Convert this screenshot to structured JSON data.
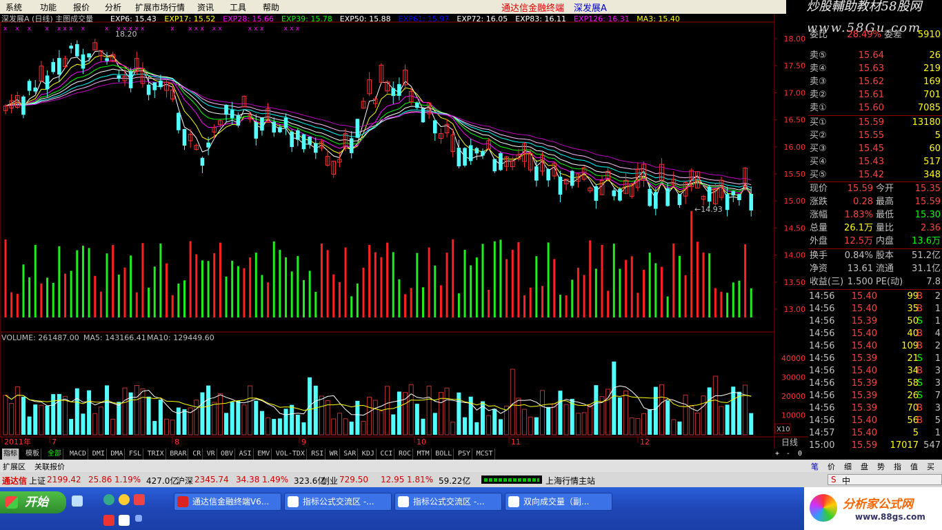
{
  "menu": {
    "items": [
      "系统",
      "功能",
      "报价",
      "分析",
      "扩展市场行情",
      "资讯",
      "工具",
      "帮助"
    ],
    "app_title": "通达信金融终端",
    "stock": "深发展A",
    "watermark1": "炒股輔助教材58股网",
    "watermark2": "www.58Gu.com"
  },
  "indicator_line": {
    "title": "深发展A (日线) 主图成交量",
    "items": [
      {
        "label": "EXP6: 15.43",
        "color": "#ffffff"
      },
      {
        "label": "EXP17: 15.52",
        "color": "#ffff00"
      },
      {
        "label": "EXP28: 15.66",
        "color": "#ff00ff"
      },
      {
        "label": "EXP39: 15.78",
        "color": "#00ff00"
      },
      {
        "label": "EXP50: 15.88",
        "color": "#ffffff"
      },
      {
        "label": "EXP61: 15.97",
        "color": "#0000ff"
      },
      {
        "label": "EXP72: 16.05",
        "color": "#ffffff"
      },
      {
        "label": "EXP83: 16.11",
        "color": "#ffffff"
      },
      {
        "label": "EXP126: 16.31",
        "color": "#ff00ff"
      },
      {
        "label": "MA3: 15.40",
        "color": "#ffff00"
      }
    ]
  },
  "price_axis": [
    "18.00",
    "17.50",
    "17.00",
    "16.50",
    "16.00",
    "15.50",
    "15.00",
    "14.50",
    "14.00",
    "13.50",
    "13.00"
  ],
  "high_label": "18.20",
  "low_label": "←14.93",
  "vol_title": {
    "label": "VOLUME: 261487.00",
    "ma5": "MA5: 143166.41",
    "ma10": "MA10: 129449.60"
  },
  "vol_axis": [
    "40000",
    "30000",
    "20000",
    "10000"
  ],
  "vol_unit": "X10",
  "date_axis": [
    "2011年",
    "7",
    "8",
    "9",
    "10",
    "11",
    "12"
  ],
  "period": "日线",
  "quote": {
    "partial": {
      "left": "委比",
      "v1": "28.49%",
      "mid": "委差",
      "v2": "5910"
    },
    "asks": [
      {
        "label": "卖⑤",
        "price": "15.64",
        "vol": "26"
      },
      {
        "label": "卖④",
        "price": "15.63",
        "vol": "219"
      },
      {
        "label": "卖③",
        "price": "15.62",
        "vol": "169"
      },
      {
        "label": "卖②",
        "price": "15.61",
        "vol": "701"
      },
      {
        "label": "卖①",
        "price": "15.60",
        "vol": "7085"
      }
    ],
    "bids": [
      {
        "label": "买①",
        "price": "15.59",
        "vol": "13180"
      },
      {
        "label": "买②",
        "price": "15.55",
        "vol": "5"
      },
      {
        "label": "买③",
        "price": "15.45",
        "vol": "60"
      },
      {
        "label": "买④",
        "price": "15.43",
        "vol": "517"
      },
      {
        "label": "买⑤",
        "price": "15.42",
        "vol": "348"
      }
    ],
    "stats": [
      {
        "l1": "现价",
        "v1": "15.59",
        "c1": "#ff4040",
        "l2": "今开",
        "v2": "15.35",
        "c2": "#ff4040"
      },
      {
        "l1": "涨跌",
        "v1": "0.28",
        "c1": "#ff4040",
        "l2": "最高",
        "v2": "15.59",
        "c2": "#ff4040"
      },
      {
        "l1": "涨幅",
        "v1": "1.83%",
        "c1": "#ff4040",
        "l2": "最低",
        "v2": "15.30",
        "c2": "#00ff00"
      },
      {
        "l1": "总量",
        "v1": "26.1万",
        "c1": "#ffff00",
        "l2": "量比",
        "v2": "2.36",
        "c2": "#ff4040"
      },
      {
        "l1": "外盘",
        "v1": "12.5万",
        "c1": "#ff4040",
        "l2": "内盘",
        "v2": "13.6万",
        "c2": "#00ff00"
      }
    ],
    "fund": [
      {
        "l1": "换手",
        "v1": "0.84%",
        "l2": "股本",
        "v2": "51.2亿"
      },
      {
        "l1": "净资",
        "v1": "13.61",
        "l2": "流通",
        "v2": "31.1亿"
      },
      {
        "l1": "收益(三)",
        "v1": "1.500",
        "l2": "PE(动)",
        "v2": "7.8"
      }
    ],
    "ticks": [
      {
        "t": "14:56",
        "p": "15.40",
        "v": "99",
        "bs": "B",
        "n": "2"
      },
      {
        "t": "14:56",
        "p": "15.40",
        "v": "35",
        "bs": "B",
        "n": "1"
      },
      {
        "t": "14:56",
        "p": "15.39",
        "v": "50",
        "bs": "S",
        "n": "1"
      },
      {
        "t": "14:56",
        "p": "15.40",
        "v": "40",
        "bs": "B",
        "n": "4"
      },
      {
        "t": "14:56",
        "p": "15.40",
        "v": "109",
        "bs": "B",
        "n": "2"
      },
      {
        "t": "14:56",
        "p": "15.39",
        "v": "21",
        "bs": "S",
        "n": "1"
      },
      {
        "t": "14:56",
        "p": "15.40",
        "v": "34",
        "bs": "B",
        "n": "3"
      },
      {
        "t": "14:56",
        "p": "15.39",
        "v": "58",
        "bs": "S",
        "n": "3"
      },
      {
        "t": "14:56",
        "p": "15.39",
        "v": "26",
        "bs": "S",
        "n": "7"
      },
      {
        "t": "14:56",
        "p": "15.39",
        "v": "70",
        "bs": "B",
        "n": "3"
      },
      {
        "t": "14:56",
        "p": "15.40",
        "v": "56",
        "bs": "B",
        "n": "5"
      },
      {
        "t": "14:57",
        "p": "15.40",
        "v": "5",
        "bs": "",
        "n": "1"
      },
      {
        "t": "15:00",
        "p": "15.59",
        "v": "17017",
        "bs": "",
        "n": "547"
      }
    ],
    "bottom_tabs": [
      "笔",
      "价",
      "细",
      "盘",
      "势",
      "指",
      "值",
      "买"
    ]
  },
  "tabs": [
    "指标",
    "模板",
    "全部",
    "MACD",
    "DMI",
    "DMA",
    "FSL",
    "TRIX",
    "BRAR",
    "CR",
    "VR",
    "OBV",
    "ASI",
    "EMV",
    "VOL-TDX",
    "RSI",
    "WR",
    "SAR",
    "KDJ",
    "CCI",
    "ROC",
    "MTM",
    "BOLL",
    "PSY",
    "MCST"
  ],
  "period_controls": [
    "+",
    "-",
    "0"
  ],
  "ext_tabs": [
    "扩展区",
    "关联报价"
  ],
  "status": [
    {
      "name": "上证",
      "val": "2199.42",
      "chg": "25.86",
      "pct": "1.19%",
      "amt": "427.0亿"
    },
    {
      "name": "沪深",
      "val": "2345.74",
      "chg": "34.38",
      "pct": "1.49%",
      "amt": "323.6亿"
    },
    {
      "name": "创业",
      "val": "729.50",
      "chg": "12.95",
      "pct": "1.81%",
      "amt": "59.22亿"
    }
  ],
  "status_brand": "通达信",
  "status_site": "上海行情主站",
  "taskbar": {
    "start": "开始",
    "buttons": [
      "通达信金融终端V6...",
      "指标公式交流区 -...",
      "指标公式交流区 -...",
      "双向成交量（副..."
    ],
    "logo": "分析家公式网",
    "logo_url": "www.88gs.com"
  },
  "colors": {
    "up": "#ff3030",
    "down": "#54ffff",
    "vol_up": "#ff2020",
    "vol_down": "#20ee20"
  }
}
